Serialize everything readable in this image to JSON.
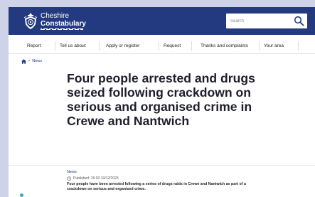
{
  "header": {
    "logo_line1": "Cheshire",
    "logo_line2": "Constabulary",
    "search_placeholder": "Search",
    "search_icon": "search-icon",
    "crest_icon": "police-crest-icon"
  },
  "nav": {
    "items": [
      "Report",
      "Tell us about",
      "Apply or register",
      "Request",
      "Thanks and complaints",
      "Your area"
    ]
  },
  "breadcrumb": {
    "home_icon": "home-icon",
    "current": "News"
  },
  "article": {
    "title": "Four people arrested and drugs seized following crackdown on serious and organised crime in Crewe and Nantwich",
    "category": "News",
    "published_label": "Published:",
    "published_time": "16:03",
    "published_date": "19/12/2023",
    "summary": "Four people have been arrested following a series of drugs raids in Crewe and Nantwich as part of a crackdown on serious and organised crime."
  },
  "colors": {
    "brand": "#233a80",
    "page_bg": "#cfd3ea",
    "title": "#1e1e2c"
  }
}
